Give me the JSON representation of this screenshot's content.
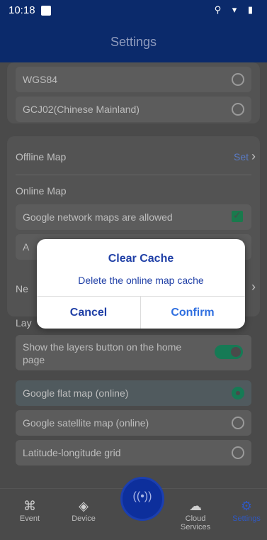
{
  "status": {
    "time": "10:18",
    "icons": "⚲ ▾ ▮"
  },
  "header": {
    "title": "Settings"
  },
  "coordinate_system": {
    "options": [
      {
        "label": "WGS84",
        "selected": false
      },
      {
        "label": "GCJ02(Chinese Mainland)",
        "selected": false
      }
    ]
  },
  "map": {
    "offline_label": "Offline Map",
    "offline_action": "Set",
    "online_label": "Online Map",
    "online_option1": "Google network maps are allowed",
    "online_option2_partial": "A",
    "network_label_partial": "Ne",
    "layers_label_partial": "Lay"
  },
  "layers": {
    "show_button_label": "Show the layers button on the home page",
    "options": [
      {
        "label": "Google flat map (online)",
        "selected": true
      },
      {
        "label": "Google satellite map (online)",
        "selected": false
      },
      {
        "label": "Latitude-longitude grid",
        "selected": false
      }
    ]
  },
  "nav": {
    "event": "Event",
    "device": "Device",
    "cloud": "Cloud Services",
    "settings": "Settings"
  },
  "dialog": {
    "title": "Clear Cache",
    "message": "Delete the online map cache",
    "cancel": "Cancel",
    "confirm": "Confirm"
  },
  "colors": {
    "primary": "#0b2a6b",
    "accent_green": "#167a55",
    "dialog_text": "#1f3fa6"
  }
}
